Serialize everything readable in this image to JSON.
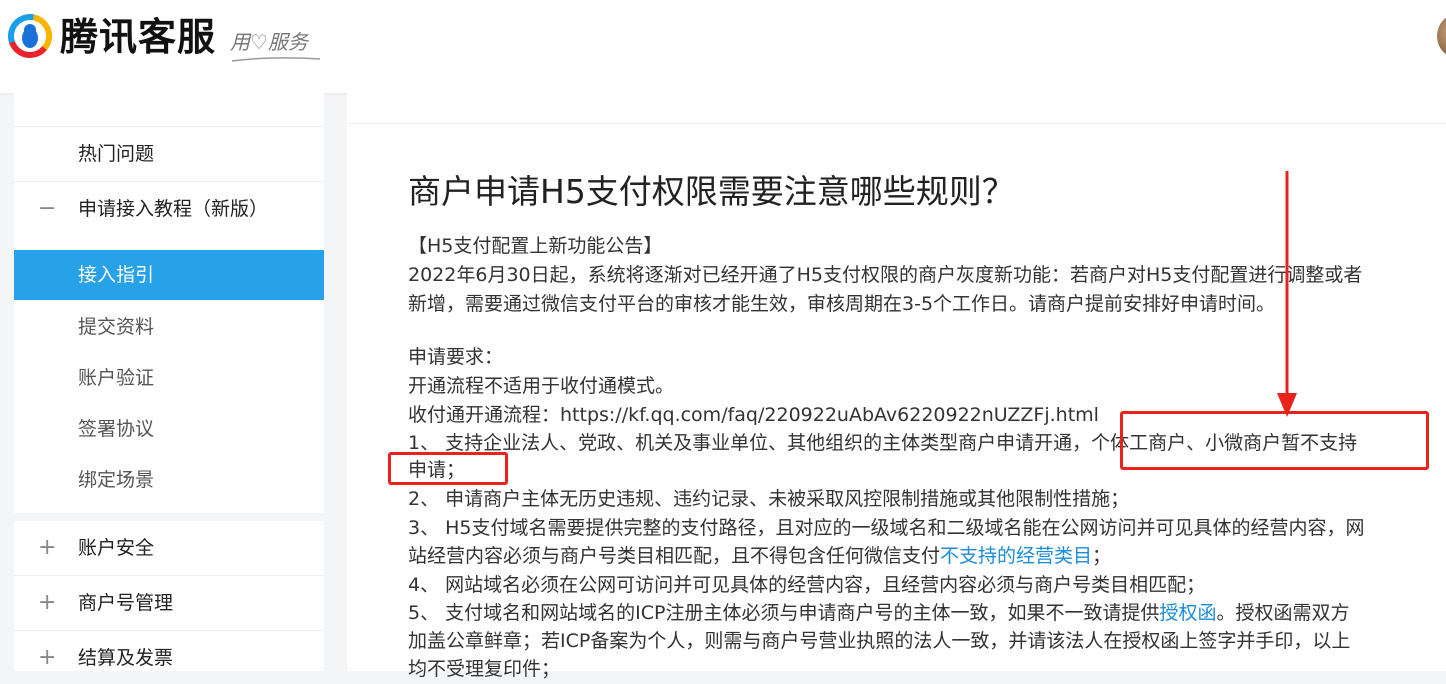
{
  "header": {
    "logo_text": "腾讯客服",
    "slogan": "用♡服务"
  },
  "sidebar": {
    "hot_issues": "热门问题",
    "apply_tutorial": "申请接入教程（新版）",
    "sub_items": [
      "接入指引",
      "提交资料",
      "账户验证",
      "签署协议",
      "绑定场景"
    ],
    "account_security": "账户安全",
    "merchant_mgmt": "商户号管理",
    "settlement": "结算及发票"
  },
  "article": {
    "title": "商户申请H5支付权限需要注意哪些规则？",
    "notice_title": "【H5支付配置上新功能公告】",
    "notice_line1": "2022年6月30日起，系统将逐渐对已经开通了H5支付权限的商户灰度新功能：若商户对H5支付配置进行调整或者",
    "notice_line2": "新增，需要通过微信支付平台的审核才能生效，审核周期在3-5个工作日。请商户提前安排好申请时间。",
    "req_title": "申请要求：",
    "req_line1": "开通流程不适用于收付通模式。",
    "req_line2": "收付通开通流程：https://kf.qq.com/faq/220922uAbAv6220922nUZZFj.html",
    "item1_a": "1、 支持企业法人、党政、机关及事业单位、其他组织的主体类型商户申请开通，",
    "item1_b": "个体工商户、小微商户暂不支持",
    "item1_c": "申请；",
    "item2": "2、 申请商户主体无历史违规、违约记录、未被采取风控限制措施或其他限制性措施；",
    "item3_a": "3、 H5支付域名需要提供完整的支付路径，且对应的一级域名和二级域名能在公网访问并可见具体的经营内容，网",
    "item3_b": "站经营内容必须与商户号类目相匹配，且不得包含任何微信支付",
    "item3_link": "不支持的经营类目",
    "item3_c": "；",
    "item4": "4、 网站域名必须在公网可访问并可见具体的经营内容，且经营内容必须与商户号类目相匹配；",
    "item5_a": "5、 支付域名和网站域名的ICP注册主体必须与申请商户号的主体一致，如果不一致请提供",
    "item5_link": "授权函",
    "item5_b": "。授权函需双方",
    "item5_c": "加盖公章鲜章；若ICP备案为个人，则需与商户号营业执照的法人一致，并请该法人在授权函上签字并手印，以上",
    "item5_d": "均不受理复印件；"
  },
  "colors": {
    "active": "#27a1e8",
    "link": "#1a8cd8",
    "highlight": "#e8231b"
  }
}
